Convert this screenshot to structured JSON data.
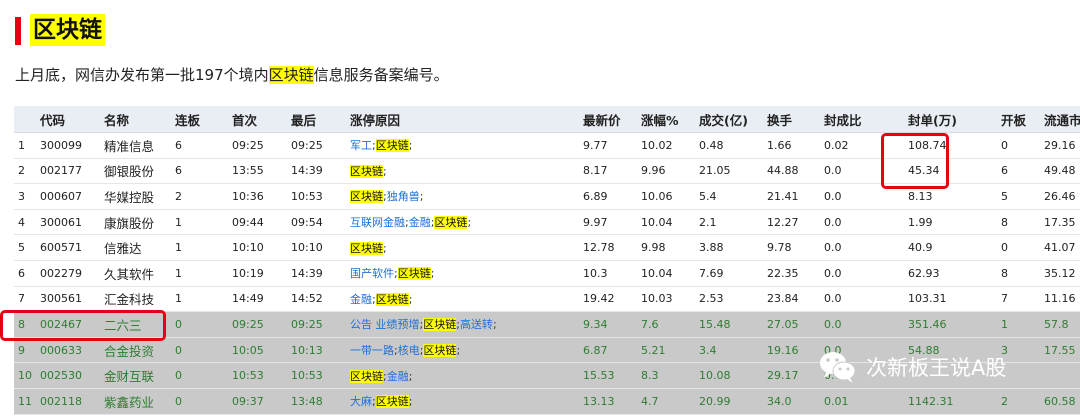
{
  "title": "区块链",
  "intro": {
    "before": "上月底，网信办发布第一批197个境内",
    "highlight": "区块链",
    "after": "信息服务备案编号。"
  },
  "table": {
    "headers": [
      "代码",
      "名称",
      "连板",
      "首次",
      "最后",
      "涨停原因",
      "最新价",
      "涨幅%",
      "成交(亿)",
      "换手",
      "封成比",
      "封单(万)",
      "开板",
      "流通市值"
    ],
    "rows": [
      {
        "idx": "1",
        "code": "300099",
        "name": "精准信息",
        "board": "6",
        "first": "09:25",
        "last": "09:25",
        "reasons": [
          {
            "t": "军工",
            "h": false
          },
          {
            "t": "区块链",
            "h": true
          }
        ],
        "price": "9.77",
        "pct": "10.02",
        "vol": "0.48",
        "turnover": "1.66",
        "ratio": "0.02",
        "seal": "108.74",
        "open": "0",
        "mcap": "29.16",
        "style": ""
      },
      {
        "idx": "2",
        "code": "002177",
        "name": "御银股份",
        "board": "6",
        "first": "13:55",
        "last": "14:39",
        "reasons": [
          {
            "t": "区块链",
            "h": true
          }
        ],
        "price": "8.17",
        "pct": "9.96",
        "vol": "21.05",
        "turnover": "44.88",
        "ratio": "0.0",
        "seal": "45.34",
        "open": "6",
        "mcap": "49.48",
        "style": ""
      },
      {
        "idx": "3",
        "code": "000607",
        "name": "华媒控股",
        "board": "2",
        "first": "10:36",
        "last": "10:53",
        "reasons": [
          {
            "t": "区块链",
            "h": true
          },
          {
            "t": "独角兽",
            "h": false
          }
        ],
        "price": "6.89",
        "pct": "10.06",
        "vol": "5.4",
        "turnover": "21.41",
        "ratio": "0.0",
        "seal": "8.13",
        "open": "5",
        "mcap": "26.46",
        "style": ""
      },
      {
        "idx": "4",
        "code": "300061",
        "name": "康旗股份",
        "board": "1",
        "first": "09:44",
        "last": "09:54",
        "reasons": [
          {
            "t": "互联网金融",
            "h": false
          },
          {
            "t": "金融",
            "h": false
          },
          {
            "t": "区块链",
            "h": true
          }
        ],
        "price": "9.97",
        "pct": "10.04",
        "vol": "2.1",
        "turnover": "12.27",
        "ratio": "0.0",
        "seal": "1.99",
        "open": "8",
        "mcap": "17.35",
        "style": ""
      },
      {
        "idx": "5",
        "code": "600571",
        "name": "信雅达",
        "board": "1",
        "first": "10:10",
        "last": "10:10",
        "reasons": [
          {
            "t": "区块链",
            "h": true
          }
        ],
        "price": "12.78",
        "pct": "9.98",
        "vol": "3.88",
        "turnover": "9.78",
        "ratio": "0.0",
        "seal": "40.9",
        "open": "0",
        "mcap": "41.07",
        "style": ""
      },
      {
        "idx": "6",
        "code": "002279",
        "name": "久其软件",
        "board": "1",
        "first": "10:19",
        "last": "14:39",
        "reasons": [
          {
            "t": "国产软件",
            "h": false
          },
          {
            "t": "区块链",
            "h": true
          }
        ],
        "price": "10.3",
        "pct": "10.04",
        "vol": "7.69",
        "turnover": "22.35",
        "ratio": "0.0",
        "seal": "62.93",
        "open": "8",
        "mcap": "35.12",
        "style": ""
      },
      {
        "idx": "7",
        "code": "300561",
        "name": "汇金科技",
        "board": "1",
        "first": "14:49",
        "last": "14:52",
        "reasons": [
          {
            "t": "金融",
            "h": false
          },
          {
            "t": "区块链",
            "h": true
          }
        ],
        "price": "19.42",
        "pct": "10.03",
        "vol": "2.53",
        "turnover": "23.84",
        "ratio": "0.0",
        "seal": "103.31",
        "open": "7",
        "mcap": "11.16",
        "style": ""
      },
      {
        "idx": "8",
        "code": "002467",
        "name": "二六三",
        "board": "0",
        "first": "09:25",
        "last": "09:25",
        "reasons": [
          {
            "t": "公告 业绩预增",
            "h": false
          },
          {
            "t": "区块链",
            "h": true
          },
          {
            "t": "高送转",
            "h": false
          }
        ],
        "price": "9.34",
        "pct": "7.6",
        "vol": "15.48",
        "turnover": "27.05",
        "ratio": "0.0",
        "seal": "351.46",
        "open": "1",
        "mcap": "57.8",
        "style": "gray"
      },
      {
        "idx": "9",
        "code": "000633",
        "name": "合金投资",
        "board": "0",
        "first": "10:05",
        "last": "10:13",
        "reasons": [
          {
            "t": "一带一路",
            "h": false
          },
          {
            "t": "核电",
            "h": false
          },
          {
            "t": "区块链",
            "h": true
          }
        ],
        "price": "6.87",
        "pct": "5.21",
        "vol": "3.4",
        "turnover": "19.16",
        "ratio": "0.0",
        "seal": "54.88",
        "open": "3",
        "mcap": "17.55",
        "style": "gray"
      },
      {
        "idx": "10",
        "code": "002530",
        "name": "金财互联",
        "board": "0",
        "first": "10:53",
        "last": "10:53",
        "reasons": [
          {
            "t": "区块链",
            "h": true
          },
          {
            "t": "金融",
            "h": false
          }
        ],
        "price": "15.53",
        "pct": "8.3",
        "vol": "10.08",
        "turnover": "29.17",
        "ratio": "0.0",
        "seal": "",
        "open": "",
        "mcap": "",
        "style": "gray"
      },
      {
        "idx": "11",
        "code": "002118",
        "name": "紫鑫药业",
        "board": "0",
        "first": "09:37",
        "last": "13:48",
        "reasons": [
          {
            "t": "大麻",
            "h": false
          },
          {
            "t": "区块链",
            "h": true
          }
        ],
        "price": "13.13",
        "pct": "4.7",
        "vol": "20.99",
        "turnover": "34.0",
        "ratio": "0.01",
        "seal": "1142.31",
        "open": "2",
        "mcap": "60.58",
        "style": "gray"
      }
    ]
  },
  "watermark": {
    "text": "次新板王说A股",
    "icon": "wechat-icon"
  },
  "colors": {
    "accent_red": "#e60012",
    "highlight": "#ffff00",
    "link_blue": "#1e6fd9",
    "row_gray": "#c9c9c9",
    "green_text": "#2e7d32"
  }
}
